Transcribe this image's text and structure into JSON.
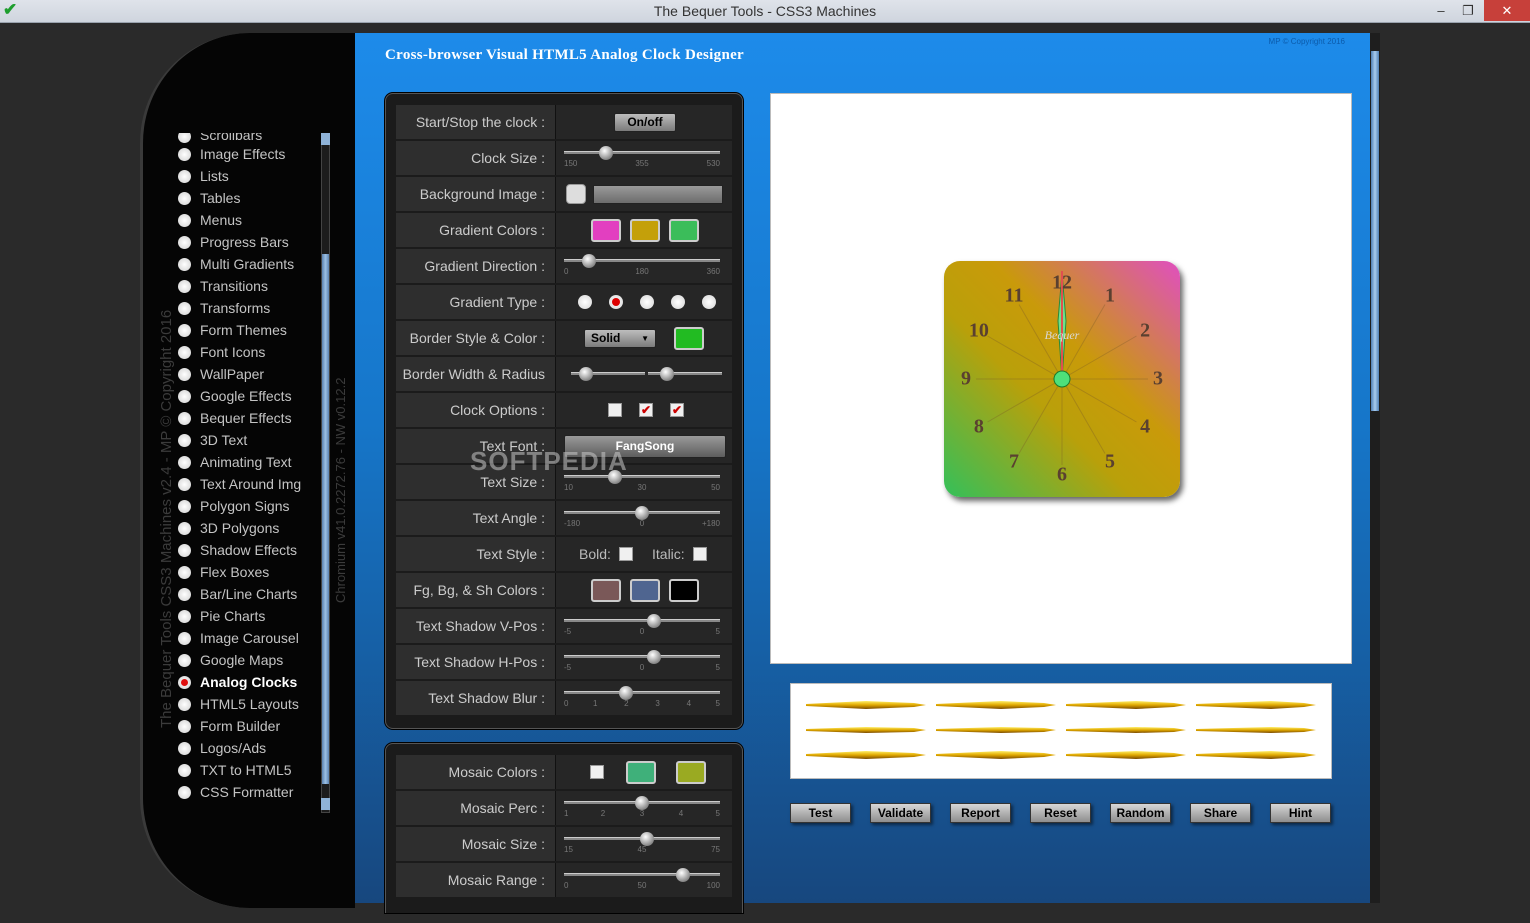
{
  "window": {
    "title": "The Bequer Tools - CSS3 Machines",
    "min": "–",
    "max": "❐",
    "close": "✕"
  },
  "sidebar": {
    "vertical_left": "The Bequer Tools CSS3 Machines v2.4 - MP © Copyright 2016",
    "vertical_right": "Chromium v41.0.2272.76 - NW v0.12.2",
    "partial_top": "Scrollbars",
    "items": [
      "Image Effects",
      "Lists",
      "Tables",
      "Menus",
      "Progress Bars",
      "Multi Gradients",
      "Transitions",
      "Transforms",
      "Form Themes",
      "Font Icons",
      "WallPaper",
      "Google Effects",
      "Bequer Effects",
      "3D Text",
      "Animating Text",
      "Text Around Img",
      "Polygon Signs",
      "3D Polygons",
      "Shadow Effects",
      "Flex Boxes",
      "Bar/Line Charts",
      "Pie Charts",
      "Image Carousel",
      "Google Maps",
      "Analog Clocks",
      "HTML5 Layouts",
      "Form Builder",
      "Logos/Ads",
      "TXT to HTML5",
      "CSS Formatter"
    ],
    "active": "Analog Clocks"
  },
  "main": {
    "heading": "Cross-browser Visual HTML5 Analog Clock Designer",
    "copyright": "MP © Copyright 2016"
  },
  "panel1": {
    "start_stop": {
      "label": "Start/Stop the clock :",
      "button": "On/off"
    },
    "clock_size": {
      "label": "Clock Size :",
      "ticks": [
        "150",
        "355",
        "530"
      ],
      "value": 0.27
    },
    "bg_image": {
      "label": "Background Image :"
    },
    "grad_colors": {
      "label": "Gradient Colors :",
      "colors": [
        "#e23fc0",
        "#c4a00a",
        "#3bbd5a"
      ]
    },
    "grad_dir": {
      "label": "Gradient Direction :",
      "ticks": [
        "0",
        "180",
        "360"
      ],
      "value": 0.16
    },
    "grad_type": {
      "label": "Gradient Type :",
      "selected": 1
    },
    "border_style": {
      "label": "Border Style & Color :",
      "value": "Solid",
      "color": "#22bb22"
    },
    "border_wr": {
      "label": "Border Width & Radius :",
      "w": 0.2,
      "r": 0.25
    },
    "clock_opts": {
      "label": "Clock Options :",
      "checks": [
        false,
        true,
        true
      ]
    },
    "text_font": {
      "label": "Text Font :",
      "value": "FangSong"
    },
    "text_size": {
      "label": "Text Size :",
      "ticks": [
        "10",
        "30",
        "50"
      ],
      "value": 0.33
    },
    "text_angle": {
      "label": "Text Angle :",
      "ticks": [
        "-180",
        "0",
        "+180"
      ],
      "value": 0.5
    },
    "text_style": {
      "label": "Text Style :",
      "bold": "Bold:",
      "italic": "Italic:"
    },
    "fg_colors": {
      "label": "Fg, Bg, & Sh Colors :",
      "colors": [
        "#7a5858",
        "#4f6590",
        "#000000"
      ]
    },
    "sh_v": {
      "label": "Text Shadow V-Pos :",
      "ticks": [
        "-5",
        "0",
        "5"
      ],
      "value": 0.58
    },
    "sh_h": {
      "label": "Text Shadow H-Pos :",
      "ticks": [
        "-5",
        "0",
        "5"
      ],
      "value": 0.58
    },
    "sh_blur": {
      "label": "Text Shadow Blur :",
      "ticks": [
        "0",
        "1",
        "2",
        "3",
        "4",
        "5"
      ],
      "value": 0.4
    }
  },
  "panel2": {
    "mosaic_colors": {
      "label": "Mosaic Colors :",
      "colors": [
        "#ffffff",
        "#3fb07a",
        "#9aaa22"
      ]
    },
    "mosaic_perc": {
      "label": "Mosaic Perc :",
      "ticks": [
        "1",
        "2",
        "3",
        "4",
        "5"
      ],
      "value": 0.5
    },
    "mosaic_size": {
      "label": "Mosaic Size :",
      "ticks": [
        "15",
        "45",
        "75"
      ],
      "value": 0.53
    },
    "mosaic_range": {
      "label": "Mosaic Range :",
      "ticks": [
        "0",
        "50",
        "100"
      ],
      "value": 0.76
    }
  },
  "clock": {
    "numbers": [
      "12",
      "1",
      "2",
      "3",
      "4",
      "5",
      "6",
      "7",
      "8",
      "9",
      "10",
      "11"
    ],
    "brand": "Bequer"
  },
  "buttons": [
    "Test",
    "Validate",
    "Report",
    "Reset",
    "Random",
    "Share",
    "Hint"
  ],
  "watermark": "SOFTPEDIA"
}
